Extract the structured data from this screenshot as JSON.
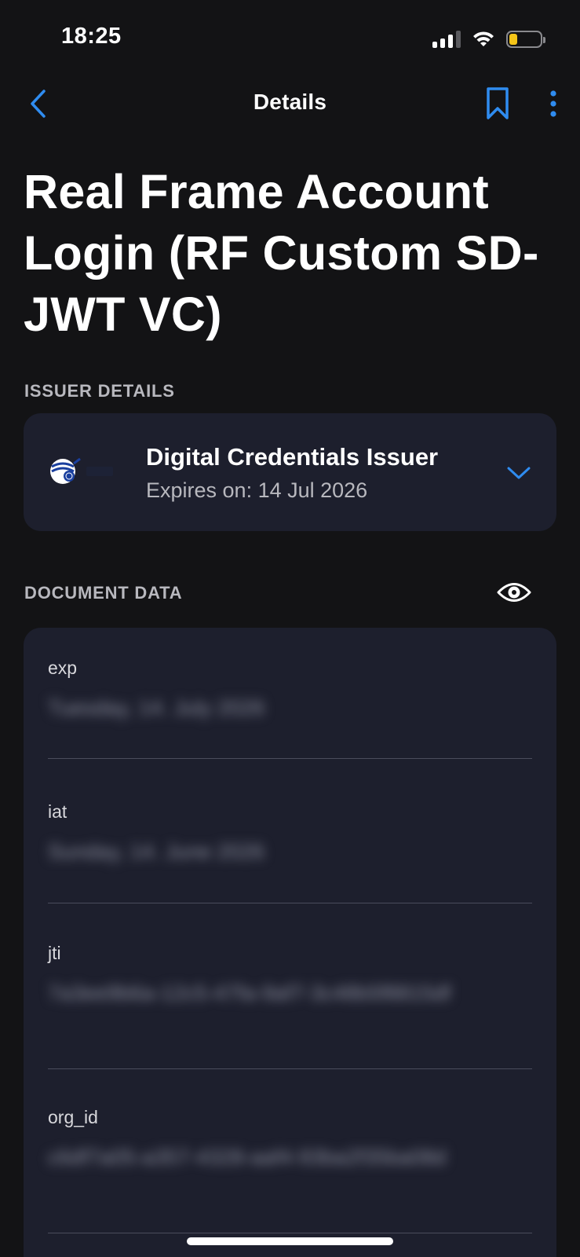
{
  "status_bar": {
    "time": "18:25",
    "battery_color": "#f5c518"
  },
  "nav": {
    "title": "Details",
    "back_icon": "chevron-left-icon",
    "bookmark_icon": "bookmark-icon",
    "more_icon": "more-vertical-icon",
    "accent_color": "#2f8cf0"
  },
  "page": {
    "title": "Real Frame Account Login (RF Custom SD-JWT VC)"
  },
  "issuer_section": {
    "label": "ISSUER DETAILS",
    "issuer_name": "Digital Credentials Issuer",
    "expiry": "Expires on: 14 Jul 2026",
    "expand_icon": "chevron-down-icon"
  },
  "document_section": {
    "label": "DOCUMENT DATA",
    "visibility_icon": "eye-icon",
    "fields": [
      {
        "label": "exp",
        "value": "Tuesday, 14. July 2026"
      },
      {
        "label": "iat",
        "value": "Sunday, 14. June 2026"
      },
      {
        "label": "jti",
        "value": "7a3ee9b6a-12c5-47fa-9af7-3c48b5f8815df"
      },
      {
        "label": "org_id",
        "value": "c6df7a05-a357-4328-aaf4-93ba2f35ba08d"
      }
    ]
  }
}
